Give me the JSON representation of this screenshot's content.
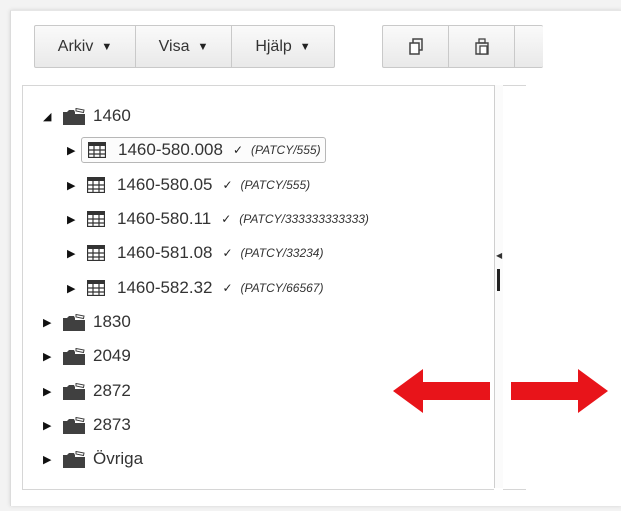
{
  "menubar": {
    "items": [
      {
        "label": "Arkiv",
        "caret": "▼"
      },
      {
        "label": "Visa",
        "caret": "▼"
      },
      {
        "label": "Hjälp",
        "caret": "▼"
      }
    ]
  },
  "toolbar_icons": [
    "copy-icon",
    "paste-icon"
  ],
  "tree": {
    "root": {
      "label": "1460",
      "expanded": true,
      "toggle": "◢"
    },
    "children": [
      {
        "label": "1460-580.008",
        "check": "✓",
        "code": "(PATCY/555)",
        "selected": true,
        "toggle": "▶"
      },
      {
        "label": "1460-580.05",
        "check": "✓",
        "code": "(PATCY/555)",
        "toggle": "▶"
      },
      {
        "label": "1460-580.11",
        "check": "✓",
        "code": "(PATCY/333333333333)",
        "toggle": "▶"
      },
      {
        "label": "1460-581.08",
        "check": "✓",
        "code": "(PATCY/33234)",
        "toggle": "▶"
      },
      {
        "label": "1460-582.32",
        "check": "✓",
        "code": "(PATCY/66567)",
        "toggle": "▶"
      }
    ],
    "siblings": [
      {
        "label": "1830",
        "toggle": "▶"
      },
      {
        "label": "2049",
        "toggle": "▶"
      },
      {
        "label": "2872",
        "toggle": "▶"
      },
      {
        "label": "2873",
        "toggle": "▶"
      },
      {
        "label": "Övriga",
        "toggle": "▶"
      }
    ]
  },
  "colors": {
    "annotation_arrow": "#e8141a",
    "toolbar_border": "#c9c9c9"
  }
}
